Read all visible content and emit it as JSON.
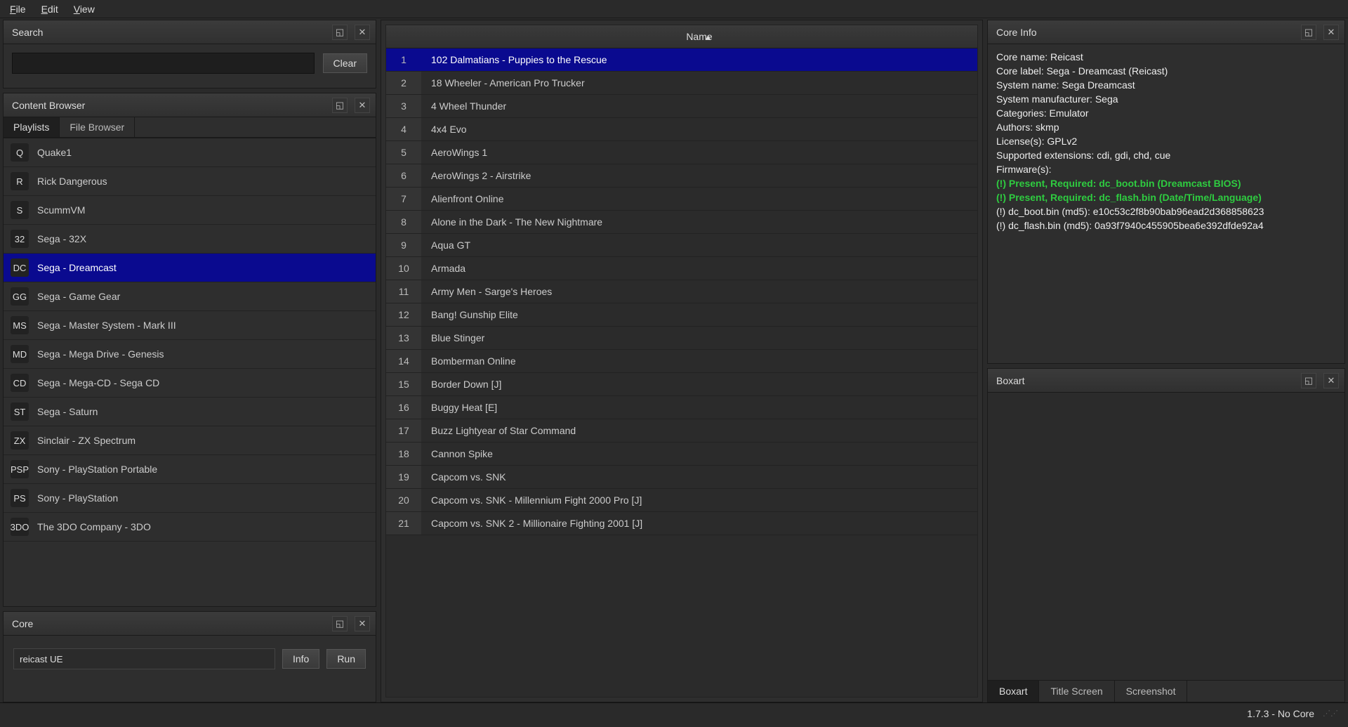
{
  "menubar": [
    "File",
    "Edit",
    "View"
  ],
  "search": {
    "title": "Search",
    "value": "",
    "placeholder": "",
    "clear": "Clear"
  },
  "content_browser": {
    "title": "Content Browser",
    "tabs": [
      "Playlists",
      "File Browser"
    ],
    "active_tab": 0,
    "selected_index": 4,
    "playlists": [
      {
        "icon": "Q",
        "label": "Quake1"
      },
      {
        "icon": "R",
        "label": "Rick Dangerous"
      },
      {
        "icon": "S",
        "label": "ScummVM"
      },
      {
        "icon": "32",
        "label": "Sega - 32X"
      },
      {
        "icon": "DC",
        "label": "Sega - Dreamcast"
      },
      {
        "icon": "GG",
        "label": "Sega - Game Gear"
      },
      {
        "icon": "MS",
        "label": "Sega - Master System - Mark III"
      },
      {
        "icon": "MD",
        "label": "Sega - Mega Drive - Genesis"
      },
      {
        "icon": "CD",
        "label": "Sega - Mega-CD - Sega CD"
      },
      {
        "icon": "ST",
        "label": "Sega - Saturn"
      },
      {
        "icon": "ZX",
        "label": "Sinclair - ZX Spectrum"
      },
      {
        "icon": "PSP",
        "label": "Sony - PlayStation Portable"
      },
      {
        "icon": "PS",
        "label": "Sony - PlayStation"
      },
      {
        "icon": "3DO",
        "label": "The 3DO Company - 3DO"
      }
    ]
  },
  "core_panel": {
    "title": "Core",
    "value": "reicast UE",
    "info": "Info",
    "run": "Run"
  },
  "games": {
    "col_name": "Name",
    "selected": 0,
    "rows": [
      "102 Dalmatians - Puppies to the Rescue",
      "18 Wheeler - American Pro Trucker",
      "4 Wheel Thunder",
      "4x4 Evo",
      "AeroWings 1",
      "AeroWings 2 - Airstrike",
      "Alienfront Online",
      "Alone in the Dark - The New Nightmare",
      "Aqua GT",
      "Armada",
      "Army Men - Sarge's Heroes",
      "Bang! Gunship Elite",
      "Blue Stinger",
      "Bomberman Online",
      "Border Down [J]",
      "Buggy Heat [E]",
      "Buzz Lightyear of Star Command",
      "Cannon Spike",
      "Capcom vs. SNK",
      "Capcom vs. SNK - Millennium Fight 2000 Pro [J]",
      "Capcom vs. SNK 2 - Millionaire Fighting 2001 [J]"
    ]
  },
  "core_info": {
    "title": "Core Info",
    "lines": [
      "Core name: Reicast",
      "Core label: Sega - Dreamcast (Reicast)",
      "System name: Sega Dreamcast",
      "System manufacturer: Sega",
      "Categories: Emulator",
      "Authors: skmp",
      "License(s): GPLv2",
      "Supported extensions: cdi, gdi, chd, cue",
      "Firmware(s):"
    ],
    "fw_green": [
      "(!) Present, Required: dc_boot.bin (Dreamcast BIOS)",
      "(!) Present, Required: dc_flash.bin (Date/Time/Language)"
    ],
    "fw_tail": [
      "(!) dc_boot.bin (md5): e10c53c2f8b90bab96ead2d368858623",
      "(!) dc_flash.bin (md5): 0a93f7940c455905bea6e392dfde92a4"
    ]
  },
  "boxart": {
    "title": "Boxart",
    "tabs": [
      "Boxart",
      "Title Screen",
      "Screenshot"
    ],
    "active_tab": 0
  },
  "status": "1.7.3 - No Core"
}
